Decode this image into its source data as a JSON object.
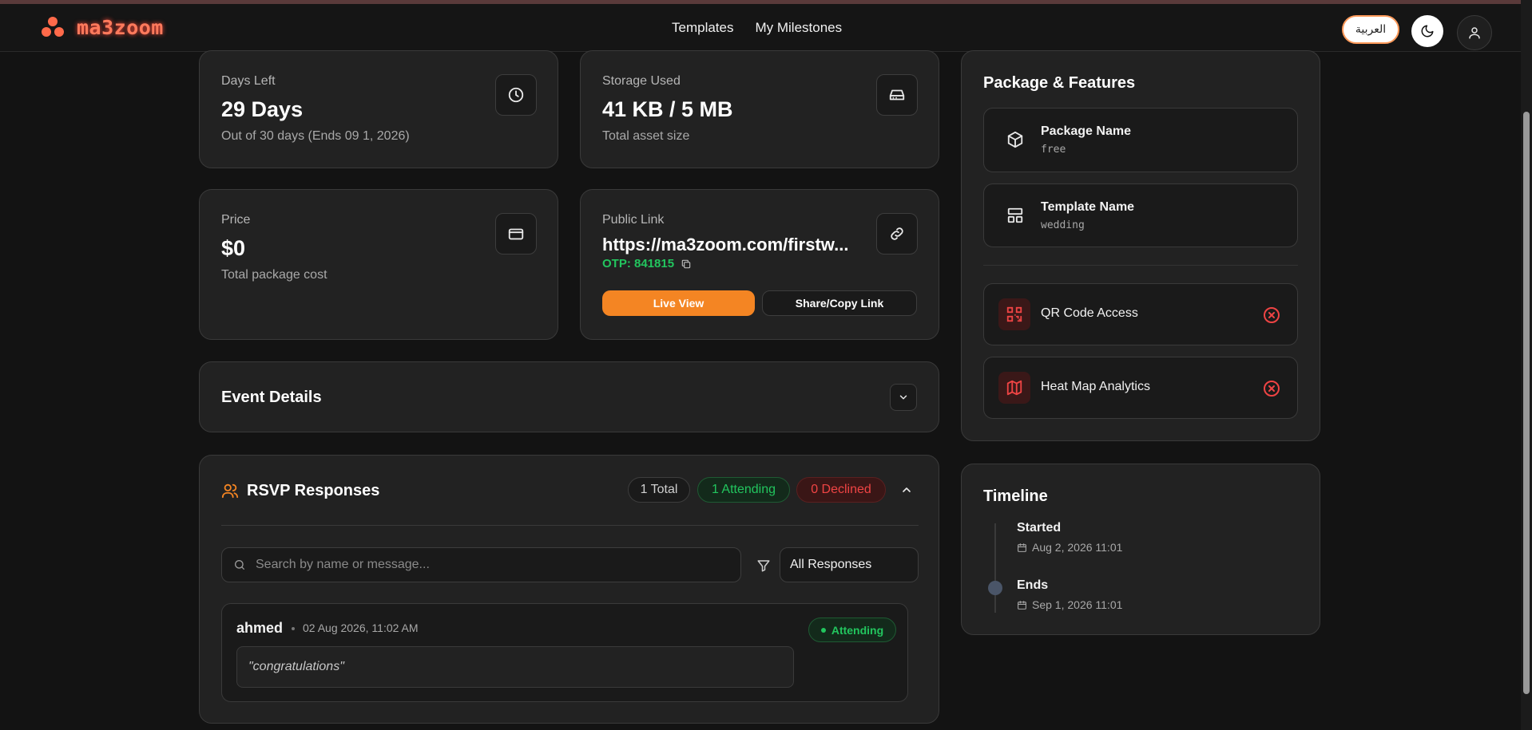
{
  "brand": {
    "name": "ma3zoom"
  },
  "nav": {
    "links": [
      "Templates",
      "My Milestones"
    ],
    "language_button": "العربية"
  },
  "stats": {
    "days_left": {
      "label": "Days Left",
      "value": "29 Days",
      "sub": "Out of 30 days (Ends 09 1, 2026)"
    },
    "storage": {
      "label": "Storage Used",
      "value": "41 KB / 5 MB",
      "sub": "Total asset size"
    },
    "price": {
      "label": "Price",
      "value": "$0",
      "sub": "Total package cost"
    },
    "public_link": {
      "label": "Public Link",
      "value": "https://ma3zoom.com/firstw...",
      "otp": "OTP: 841815",
      "live_view": "Live View",
      "share": "Share/Copy Link"
    }
  },
  "event_details": {
    "title": "Event Details"
  },
  "rsvp": {
    "title": "RSVP Responses",
    "total": "1 Total",
    "attending": "1 Attending",
    "declined": "0 Declined",
    "search_placeholder": "Search by name or message...",
    "filter_value": "All Responses",
    "responses": [
      {
        "name": "ahmed",
        "date": "02 Aug 2026, 11:02 AM",
        "status": "Attending",
        "message": "\"congratulations\""
      }
    ]
  },
  "package": {
    "title": "Package & Features",
    "package_name": {
      "label": "Package Name",
      "value": "free"
    },
    "template_name": {
      "label": "Template Name",
      "value": "wedding"
    },
    "features": [
      {
        "label": "QR Code Access",
        "icon": "qr-code-icon",
        "enabled": false
      },
      {
        "label": "Heat Map Analytics",
        "icon": "map-icon",
        "enabled": false
      }
    ]
  },
  "timeline": {
    "title": "Timeline",
    "items": [
      {
        "label": "Started",
        "date": "Aug 2, 2026 11:01"
      },
      {
        "label": "Ends",
        "date": "Sep 1, 2026 11:01"
      }
    ]
  },
  "colors": {
    "accent": "#f48523",
    "success": "#22c55e",
    "danger": "#ef4444",
    "background": "#131313",
    "card": "#222222"
  }
}
